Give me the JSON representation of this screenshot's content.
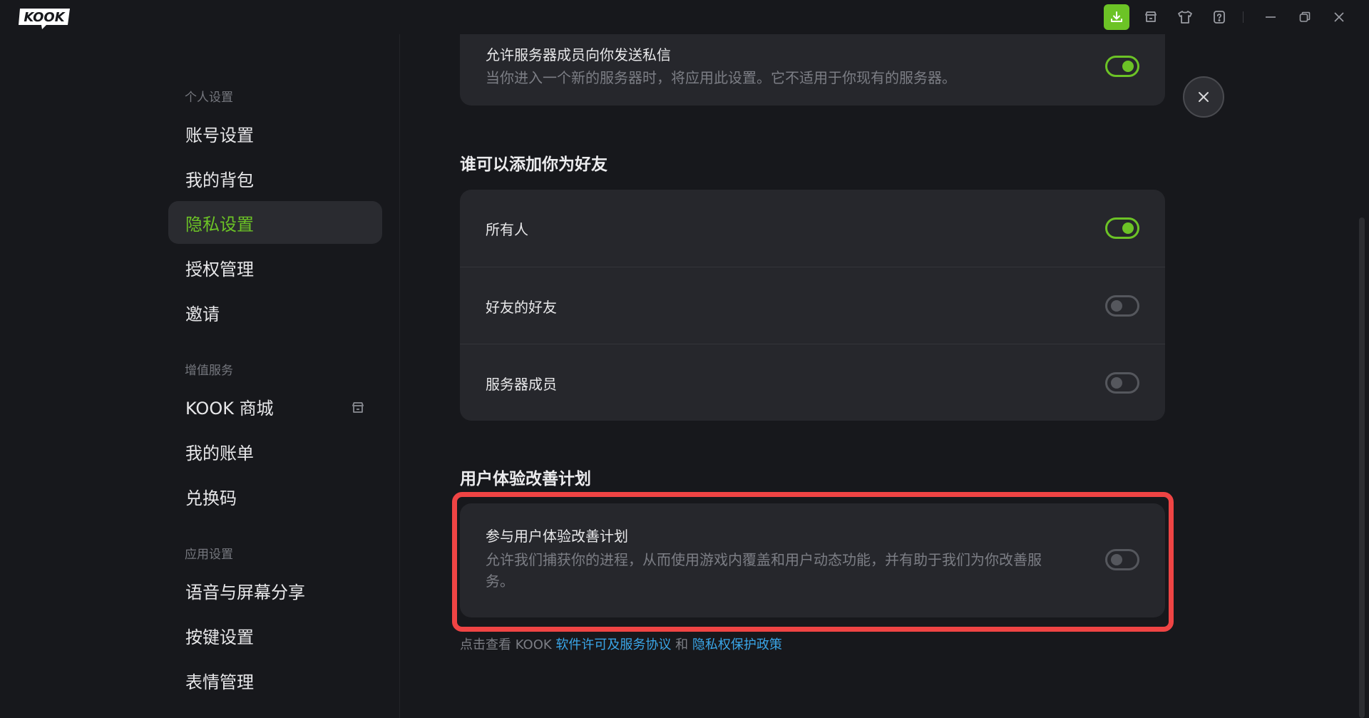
{
  "app": {
    "logo_text": "KOOK"
  },
  "titlebar": {
    "icons": [
      "download-icon",
      "store-icon",
      "shirt-icon",
      "help-icon",
      "minimize-icon",
      "restore-icon",
      "close-icon"
    ],
    "accent": "#6cc326"
  },
  "sidebar": {
    "sections": [
      {
        "header": "个人设置",
        "items": [
          "账号设置",
          "我的背包",
          "隐私设置",
          "授权管理",
          "邀请"
        ]
      },
      {
        "header": "增值服务",
        "items": [
          "KOOK 商城",
          "我的账单",
          "兑换码"
        ]
      },
      {
        "header": "应用设置",
        "items": [
          "语音与屏幕分享",
          "按键设置",
          "表情管理"
        ]
      }
    ],
    "active_item": "隐私设置"
  },
  "main": {
    "dm_setting": {
      "title": "允许服务器成员向你发送私信",
      "description": "当你进入一个新的服务器时，将应用此设置。它不适用于你现有的服务器。",
      "enabled": true
    },
    "friends_group": {
      "title": "谁可以添加你为好友",
      "rows": [
        {
          "label": "所有人",
          "enabled": true
        },
        {
          "label": "好友的好友",
          "enabled": false
        },
        {
          "label": "服务器成员",
          "enabled": false
        }
      ]
    },
    "ux_group": {
      "title": "用户体验改善计划",
      "row": {
        "title": "参与用户体验改善计划",
        "description_line1": "允许我们捕获你的进程，从而使用游戏内覆盖和用户动态功能，并有助于我们为你改善服",
        "description_line2": "务。",
        "enabled": false
      }
    },
    "footer": {
      "prefix": "点击查看 KOOK ",
      "link1": "软件许可及服务协议",
      "middle": " 和 ",
      "link2": "隐私权保护政策"
    }
  },
  "colors": {
    "highlight": "#ef4444",
    "link": "#3aa6e8",
    "toggle_on": "#6cc326"
  }
}
